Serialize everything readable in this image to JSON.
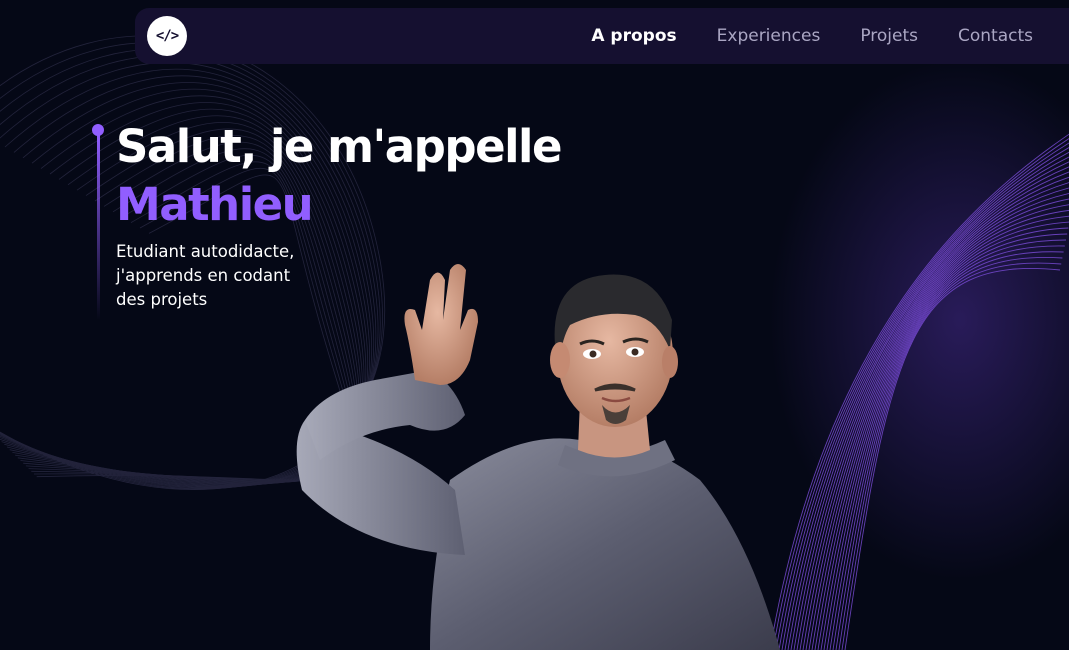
{
  "nav": {
    "logo_text": "</>",
    "links": [
      {
        "label": "A propos",
        "active": true
      },
      {
        "label": "Experiences",
        "active": false
      },
      {
        "label": "Projets",
        "active": false
      },
      {
        "label": "Contacts",
        "active": false
      }
    ]
  },
  "hero": {
    "greeting": "Salut, je m'appelle",
    "name": "Mathieu",
    "subtitle_lines": [
      "Etudiant autodidacte,",
      "j'apprends en codant",
      "des projets"
    ]
  },
  "colors": {
    "background": "#050816",
    "navbar": "#151030",
    "accent": "#915eff",
    "nav_inactive": "#aaa6c3",
    "text": "#ffffff"
  },
  "icons": {
    "logo": "code-brackets-icon"
  }
}
